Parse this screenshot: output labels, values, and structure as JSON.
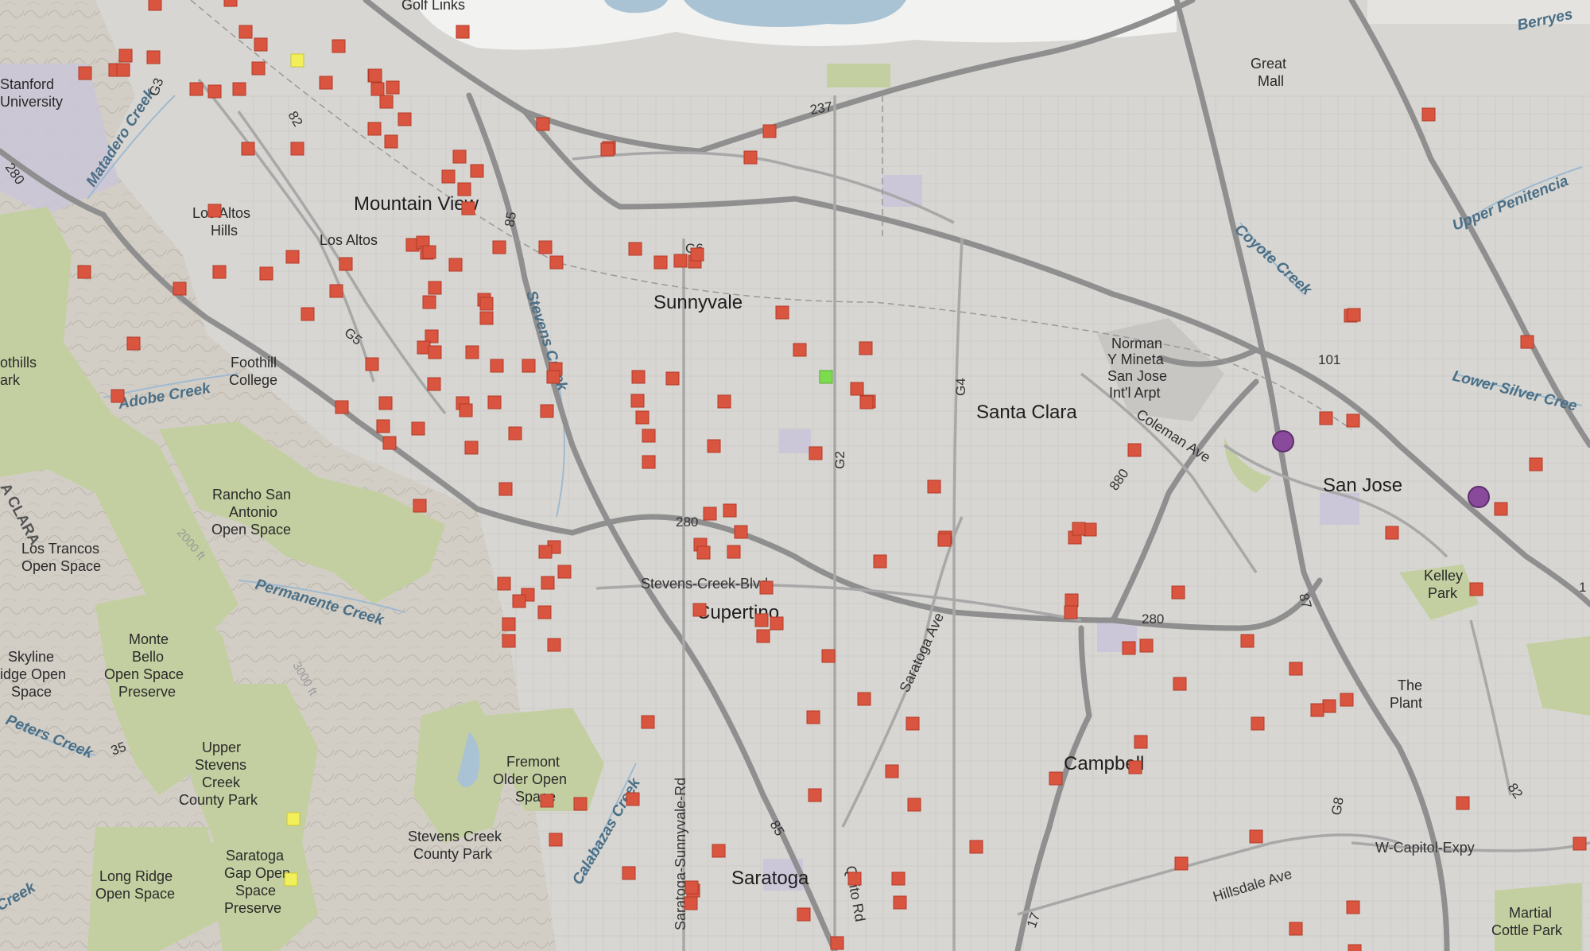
{
  "map": {
    "labels": {
      "golf_links": "Golf Links",
      "stanford": "Stanford",
      "university": "University",
      "great": "Great",
      "mall": "Mall",
      "berryessa": "Berryes",
      "mountain_view": "Mountain View",
      "los_altos_hills_1": "Los Altos",
      "los_altos_hills_2": "Hills",
      "los_altos": "Los Altos",
      "sunnyvale": "Sunnyvale",
      "santa_clara": "Santa Clara",
      "san_jose": "San Jose",
      "cupertino": "Cupertino",
      "campbell": "Campbell",
      "saratoga": "Saratoga",
      "foothill_1": "Foothill",
      "foothill_2": "College",
      "foothills_1": "othills",
      "foothills_2": "ark",
      "airport_1": "Norman",
      "airport_2": "Y Mineta",
      "airport_3": "San Jose",
      "airport_4": "Int'l Arpt",
      "rancho_1": "Rancho San",
      "rancho_2": "Antonio",
      "rancho_3": "Open Space",
      "trancos_1": "Los Trancos",
      "trancos_2": "Open Space",
      "monte_1": "Monte",
      "monte_2": "Bello",
      "monte_3": "Open Space",
      "monte_4": "Preserve",
      "skyline_1": "Skyline",
      "skyline_2": "idge Open",
      "skyline_3": "Space",
      "upper_1": "Upper",
      "upper_2": "Stevens",
      "upper_3": "Creek",
      "upper_4": "County Park",
      "fremont_1": "Fremont",
      "fremont_2": "Older Open",
      "fremont_3": "Space",
      "scc_park_1": "Stevens Creek",
      "scc_park_2": "County Park",
      "saratoga_gap_1": "Saratoga",
      "saratoga_gap_2": "Gap Open",
      "saratoga_gap_3": "Space",
      "saratoga_gap_4": "Preserve",
      "long_ridge_1": "Long Ridge",
      "long_ridge_2": "Open Space",
      "kelley_1": "Kelley",
      "kelley_2": "Park",
      "plant_1": "The",
      "plant_2": "Plant",
      "martial_1": "Martial",
      "martial_2": "Cottle Park",
      "santa_clara_county": "A CLARA",
      "matadero_creek": "Matadero Creek",
      "adobe_creek": "Adobe Creek",
      "stevens_creek": "Stevens Creek",
      "permanente_creek": "Permanente Creek",
      "peters_creek": "Peters Creek",
      "calabazas_creek": "Calabazas Creek",
      "coyote_creek": "Coyote Creek",
      "upper_penitencia": "Upper Penitencia",
      "lower_silver": "Lower Silver Cree",
      "creek_left": "Creek",
      "stevens_creek_blvd": "Stevens-Creek-Blvd",
      "coleman_ave": "Coleman Ave",
      "saratoga_ave": "Saratoga Ave",
      "saratoga_sunnyvale_rd": "Saratoga-Sunnyvale-Rd",
      "quito_rd": "Quito Rd",
      "w_capitol_expy": "W-Capitol-Expy",
      "hillsdale_ave": "Hillsdale Ave",
      "contour_2000": "2000 ft",
      "contour_3000": "3000 ft",
      "r280_a": "280",
      "r280_b": "280",
      "r280_c": "280",
      "r237": "237",
      "r101": "101",
      "r880": "880",
      "r87": "87",
      "r85_a": "85",
      "r85_b": "85",
      "r82_a": "82",
      "r82_b": "82",
      "r17": "17",
      "r35": "35",
      "g2": "G2",
      "g3": "G3",
      "g4": "G4",
      "g5": "G5",
      "g6": "G6",
      "g8": "G8",
      "r1_edge": "1"
    },
    "colors": {
      "land": "#d8d6d2",
      "park": "#c3cfa0",
      "water": "#a9c3d4",
      "marker_red": "#d9553f",
      "marker_yellow": "#f2f05a",
      "marker_green": "#7ddc4e",
      "marker_purple": "#8a4a9c"
    },
    "marker_counts": {
      "red": 200,
      "yellow": 3,
      "green": 1,
      "purple": 2
    }
  }
}
